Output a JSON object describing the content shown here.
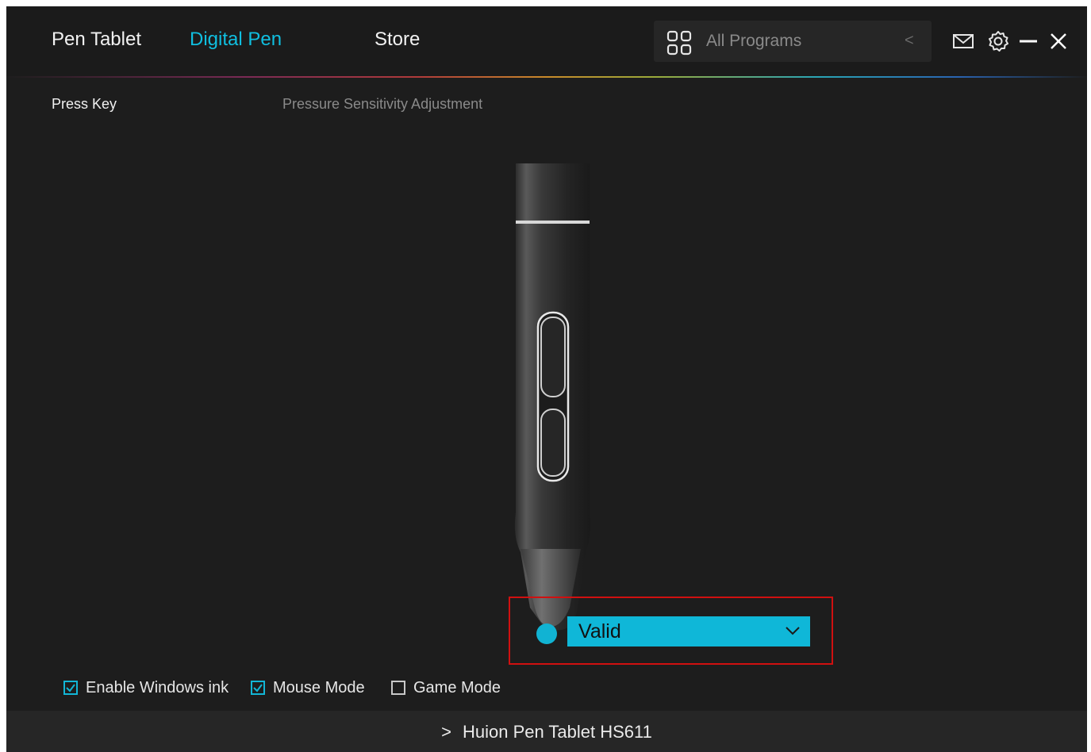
{
  "nav": {
    "tabs": [
      {
        "label": "Pen Tablet",
        "active": false
      },
      {
        "label": "Digital Pen",
        "active": true
      },
      {
        "label": "Store",
        "active": false
      }
    ],
    "program_selector": {
      "label": "All Programs",
      "icon": "grid-icon",
      "arrow": "<"
    },
    "window_controls": [
      "mail-icon",
      "gear-icon",
      "minimize-icon",
      "close-icon"
    ]
  },
  "subtabs": [
    {
      "label": "Press Key",
      "active": true
    },
    {
      "label": "Pressure Sensitivity Adjustment",
      "active": false
    }
  ],
  "pen": {
    "tip_function": {
      "value": "Valid"
    }
  },
  "options": [
    {
      "label": "Enable Windows ink",
      "checked": true
    },
    {
      "label": "Mouse Mode",
      "checked": true
    },
    {
      "label": "Game Mode",
      "checked": false
    }
  ],
  "footer": {
    "chevron": ">",
    "device": "Huion Pen Tablet HS611"
  },
  "colors": {
    "accent": "#10bfe0",
    "background": "#1d1d1d",
    "highlight_box": "#d01010",
    "dropdown_bg": "#0fb7d8"
  }
}
